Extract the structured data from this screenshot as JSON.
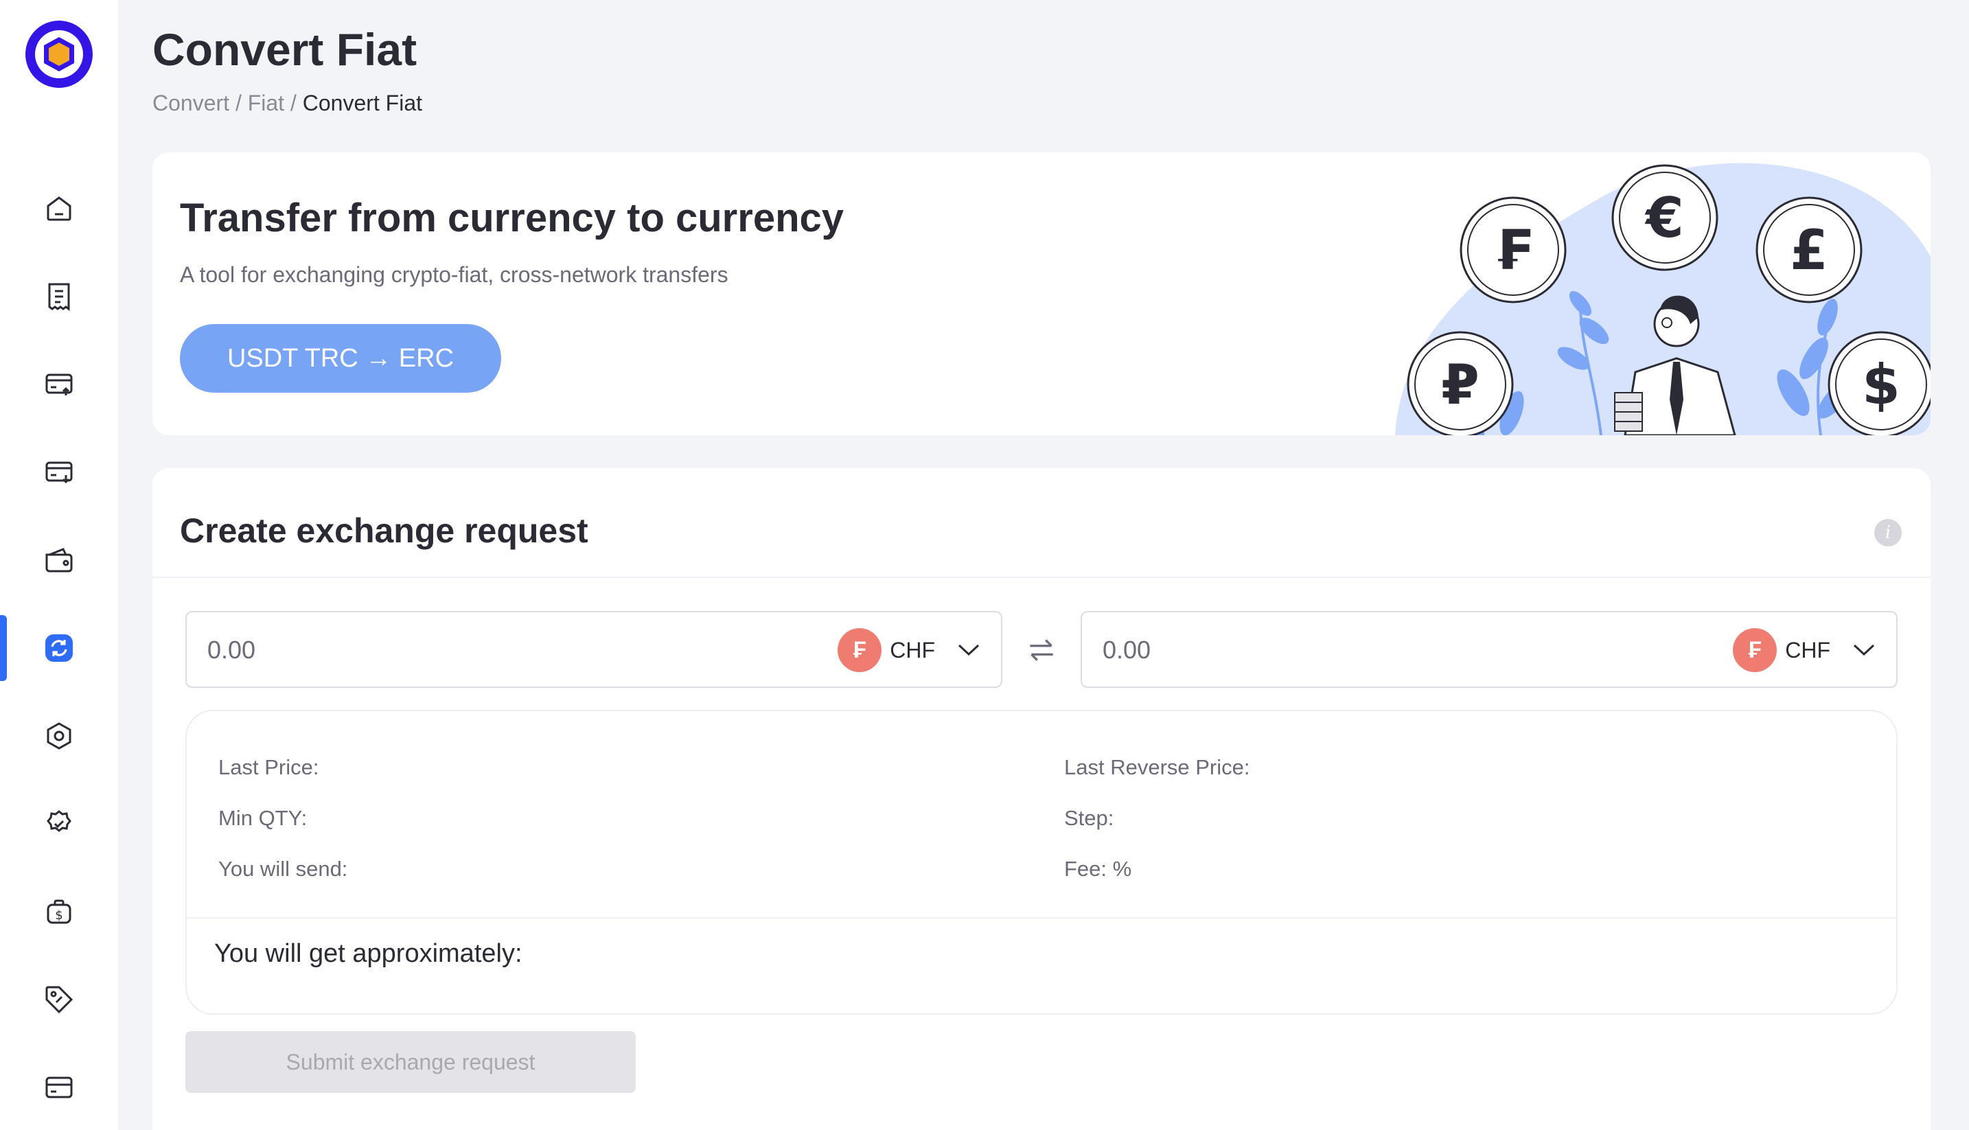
{
  "header": {
    "title": "Convert Fiat",
    "breadcrumb": {
      "part1": "Convert",
      "sep": "/",
      "part2": "Fiat",
      "current": "Convert Fiat"
    }
  },
  "sidebar": {
    "items": [
      {
        "icon": "home-icon"
      },
      {
        "icon": "receipt-icon"
      },
      {
        "icon": "card-deposit-icon"
      },
      {
        "icon": "card-withdraw-icon"
      },
      {
        "icon": "wallet-icon"
      },
      {
        "icon": "convert-icon",
        "active": true
      },
      {
        "icon": "settings-hexagon-icon"
      },
      {
        "icon": "verified-badge-icon"
      },
      {
        "icon": "money-bag-icon"
      },
      {
        "icon": "tag-icon"
      },
      {
        "icon": "credit-card-icon"
      }
    ],
    "accent": "#2f6cf6"
  },
  "banner": {
    "title": "Transfer from currency to currency",
    "subtitle": "A tool for exchanging crypto-fiat, cross-network transfers",
    "button": "USDT TRC → ERC",
    "coins": [
      "₣",
      "€",
      "£",
      "₽",
      "$"
    ]
  },
  "exchange": {
    "title": "Create exchange request",
    "from": {
      "placeholder": "0.00",
      "currency": "CHF",
      "currency_symbol": "₣"
    },
    "to": {
      "placeholder": "0.00",
      "currency": "CHF",
      "currency_symbol": "₣"
    },
    "details": {
      "last_price": "Last Price:",
      "last_reverse_price": "Last Reverse Price:",
      "min_qty": "Min QTY:",
      "step": "Step:",
      "you_will_send": "You will send:",
      "fee": "Fee: %"
    },
    "approx": "You will get approximately:",
    "submit": "Submit exchange request"
  },
  "colors": {
    "brand": "#3316e6",
    "button": "#77a4f5",
    "chf": "#ee7c70"
  }
}
